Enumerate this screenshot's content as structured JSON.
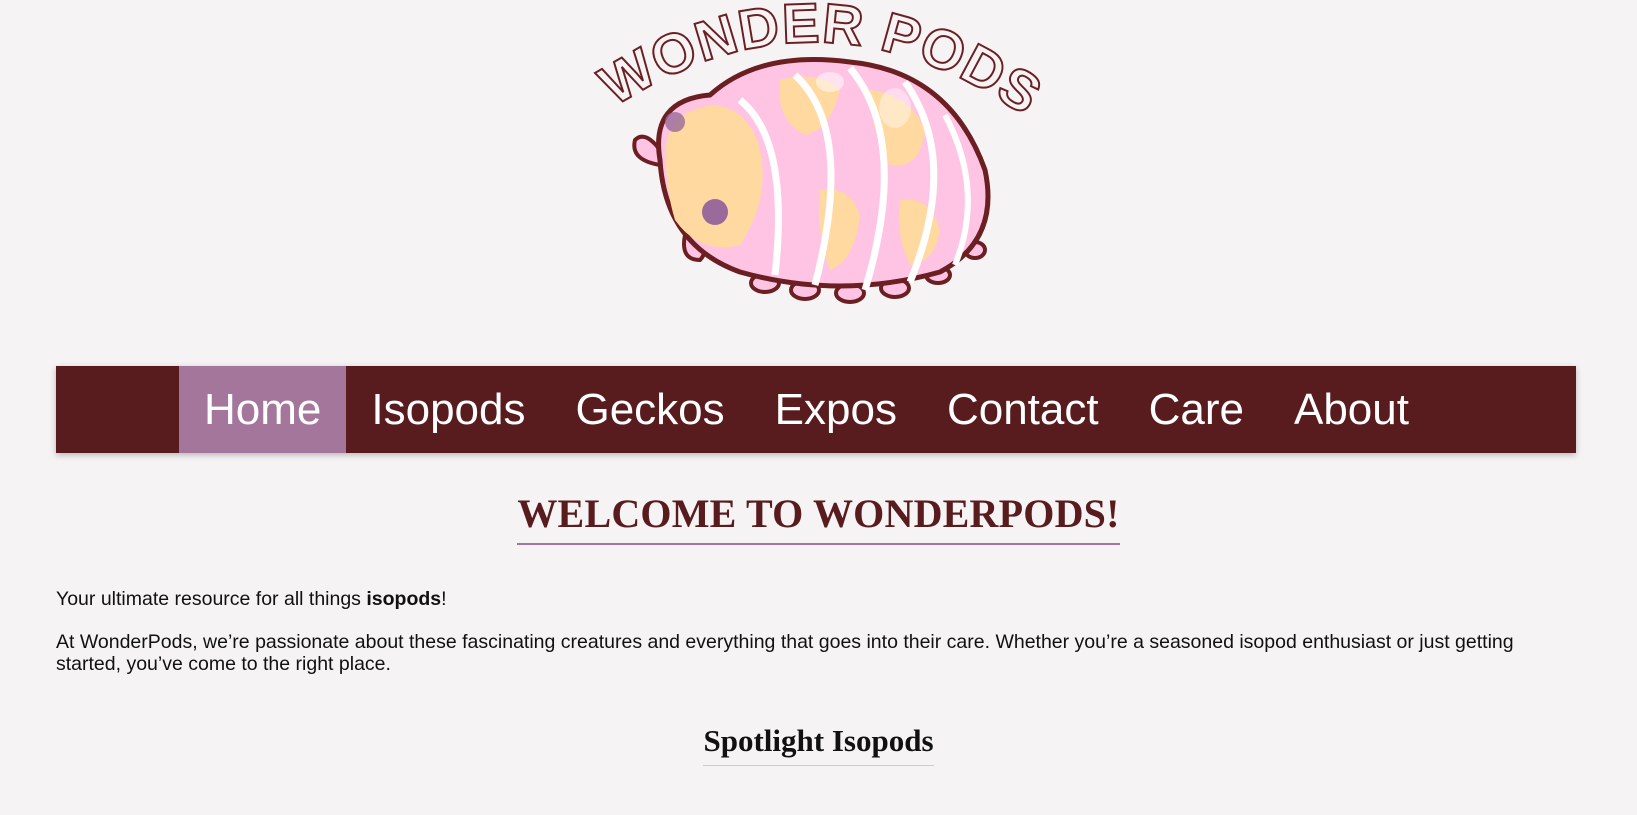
{
  "logo": {
    "text": "WONDER PODS",
    "colors": {
      "outline": "#6b1f22",
      "pink": "#ffc4e4",
      "peach": "#ffd9a0",
      "stripe": "#ffffff",
      "eye": "#9a6a9a"
    }
  },
  "nav": {
    "items": [
      {
        "label": "Home",
        "active": true
      },
      {
        "label": "Isopods"
      },
      {
        "label": "Geckos"
      },
      {
        "label": "Expos"
      },
      {
        "label": "Contact"
      },
      {
        "label": "Care"
      },
      {
        "label": "About"
      }
    ],
    "colors": {
      "bar": "#591c1e",
      "active": "#a4769c"
    }
  },
  "main": {
    "title": "WELCOME TO WONDERPODS!",
    "intro_prefix": "Your ultimate resource for all things ",
    "intro_bold": "isopods",
    "intro_suffix": "!",
    "paragraph": "At WonderPods, we’re passionate about these fascinating creatures and everything that goes into their care. Whether you’re a seasoned isopod enthusiast or just getting started, you’ve come to the right place.",
    "spotlight_title": "Spotlight Isopods"
  }
}
